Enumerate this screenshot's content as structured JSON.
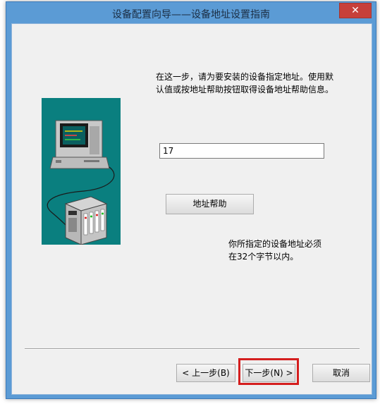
{
  "window": {
    "title": "设备配置向导——设备地址设置指南",
    "close_glyph": "✕"
  },
  "instruction": {
    "line1": "在这一步，请为要安装的设备指定地址。使用默",
    "line2": "认值或按地址帮助按钮取得设备地址帮助信息。"
  },
  "address": {
    "value": "17"
  },
  "buttons": {
    "help": "地址帮助",
    "back": "< 上一步(B)",
    "next": "下一步(N) >",
    "cancel": "取消"
  },
  "note": {
    "line1": "你所指定的设备地址必须",
    "line2": "在32个字节以内。"
  },
  "colors": {
    "titlebar": "#5b9bd5",
    "client_bg": "#f0f0f0",
    "illustration_bg": "#0a7f7f",
    "highlight": "#d41e1e",
    "close_button": "#c7403a"
  },
  "icons": {
    "illustration": "computer-and-plc-device-illustration",
    "close": "close-icon"
  }
}
